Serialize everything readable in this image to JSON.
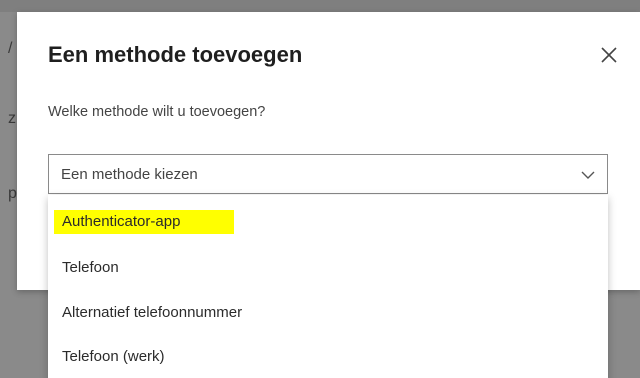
{
  "background": {
    "left_letters": [
      "/",
      "z",
      "p"
    ]
  },
  "dialog": {
    "title": "Een methode toevoegen",
    "close_icon": "close-icon",
    "prompt": "Welke methode wilt u toevoegen?",
    "select": {
      "value": "Een methode kiezen",
      "icon": "chevron-down-icon"
    },
    "options": [
      {
        "label": "Authenticator-app",
        "highlighted": true
      },
      {
        "label": "Telefoon"
      },
      {
        "label": "Alternatief telefoonnummer"
      },
      {
        "label": "Telefoon (werk)"
      }
    ]
  },
  "colors": {
    "overlay": "#8a8a8a",
    "dialog": "#ffffff",
    "highlight": "#ffff00",
    "text": "#2b2b2b"
  }
}
